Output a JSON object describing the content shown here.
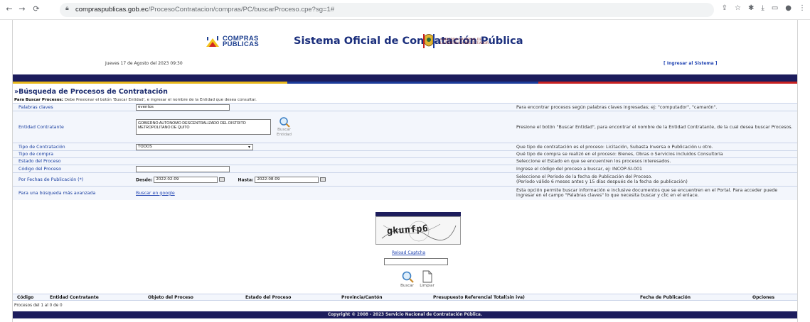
{
  "browser": {
    "url_host": "compraspublicas.gob.ec",
    "url_path": "/ProcesoContratacion/compras/PC/buscarProceso.cpe?sg=1#"
  },
  "header": {
    "logo_line1": "COMPRAS",
    "logo_line2": "PÚBLICAS",
    "title": "Sistema Oficial de Contratación Pública",
    "gov_line1": "GOBIERNO NACIONAL DE",
    "gov_line2": "LA REPÚBLICA DEL ECUADOR",
    "date": "Jueves 17 de Agosto del 2023 09:30",
    "login": "[ Ingresar al Sistema ]"
  },
  "section": {
    "title": "»Búsqueda de Procesos de Contratación",
    "instr_bold": "Para Buscar Procesos:",
    "instr_text": " Debe Presionar el botón 'Buscar Entidad', e ingresar el nombre de la Entidad que desea consultar."
  },
  "form": {
    "keywords": {
      "label": "Palabras claves",
      "value": "eventos",
      "help": "Para encontrar procesos según palabras claves ingresadas; ej: \"computador\", \"camarón\"."
    },
    "entity": {
      "label": "Entidad Contratante",
      "value": "GOBIERNO AUTONOMO DESCENTRALIZADO DEL DISTRITO METROPOLITANO DE QUITO",
      "button_line1": "Buscar",
      "button_line2": "Entidad",
      "help": "Presione el botón \"Buscar Entidad\", para encontrar el nombre de la Entidad Contratante, de la cual desea buscar Procesos."
    },
    "type": {
      "label": "Tipo de Contratación",
      "value": "TODOS",
      "help": "Que tipo de contratación es el proceso: Licitación, Subasta Inversa o Publicación u otro."
    },
    "purchase": {
      "label": "Tipo de compra",
      "help": "Qué tipo de compra se realizó en el proceso: Bienes, Obras o Servicios incluidos Consultoría"
    },
    "state": {
      "label": "Estado del Proceso",
      "help": "Seleccione el Estado en que se encuentren los procesos interesados."
    },
    "code": {
      "label": "Código del Proceso",
      "value": "",
      "help": "Ingrese el código del proceso a buscar, ej: INCOP-SI-001"
    },
    "dates": {
      "label": "Por Fechas de Publicación (*)",
      "from_label": "Desde:",
      "from_value": "2022-02-09",
      "to_label": "Hasta:",
      "to_value": "2022-08-09",
      "help1": "Seleccione el Período de la fecha de Publicación del Proceso.",
      "help2": "(Período válido 6 meses antes y 15 días después de la fecha de publicación)"
    },
    "advanced": {
      "label": "Para una búsqueda más avanzada",
      "link": "Buscar en google",
      "help": "Esta opción permite buscar información e inclusive documentos que se encuentren en el Portal. Para acceder puede ingresar en el campo \"Palabras claves\" lo que necesita buscar y clic en el enlace."
    }
  },
  "captcha": {
    "text": "gkunfp6",
    "reload": "Reload Captcha",
    "input": ""
  },
  "buttons": {
    "search": "Buscar",
    "clear": "Limpiar"
  },
  "results": {
    "columns": [
      "Código",
      "Entidad Contratante",
      "Objeto del Proceso",
      "Estado del Proceso",
      "Provincia/Cantón",
      "Presupuesto Referencial Total(sin iva)",
      "Fecha de Publicación",
      "Opciones"
    ],
    "count": "Procesos del 1 al 0 de 0"
  },
  "footer": "Copyright © 2008 - 2023 Servicio Nacional de Contratación Pública."
}
